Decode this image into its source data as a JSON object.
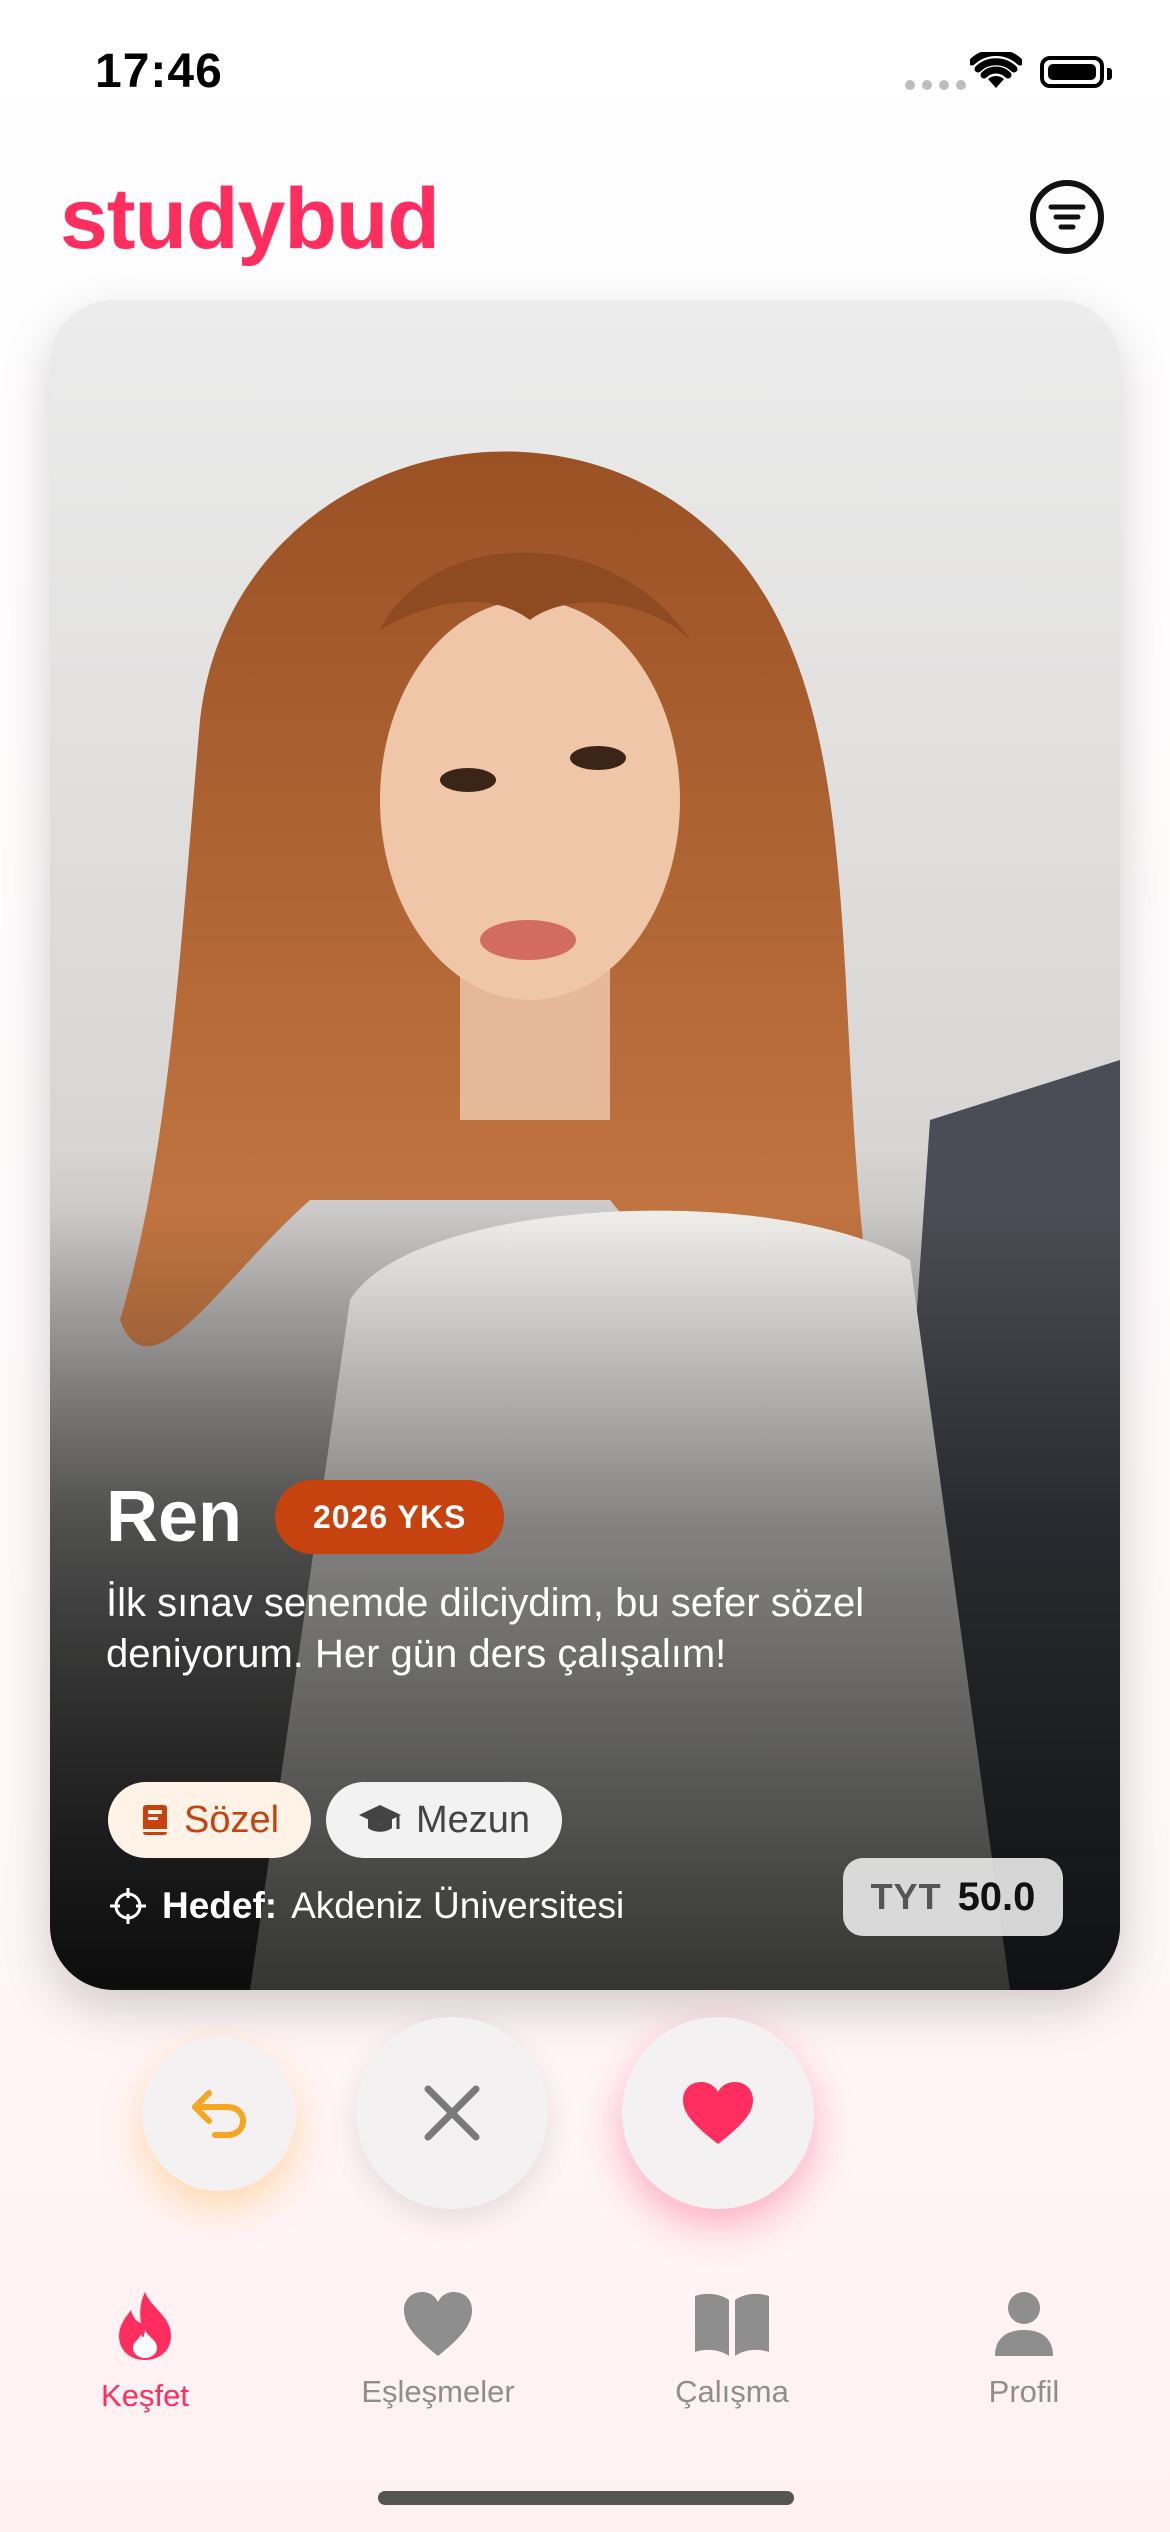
{
  "status_bar": {
    "time": "17:46"
  },
  "header": {
    "logo": "studybud",
    "filter_icon": "filter-icon"
  },
  "profile": {
    "name": "Ren",
    "exam_badge": "2026 YKS",
    "bio": "İlk sınav senemde dilciydim, bu sefer sözel deniyorum. Her gün ders çalışalım!",
    "tags": [
      {
        "label": "Sözel",
        "icon": "book-icon"
      },
      {
        "label": "Mezun",
        "icon": "graduation-cap-icon"
      }
    ],
    "goal_label": "Hedef:",
    "goal_value": "Akdeniz Üniversitesi",
    "score_label": "TYT",
    "score_value": "50.0"
  },
  "actions": {
    "undo": "undo-icon",
    "dislike": "close-icon",
    "like": "heart-icon"
  },
  "tabs": [
    {
      "label": "Keşfet",
      "icon": "flame-icon",
      "active": true
    },
    {
      "label": "Eşleşmeler",
      "icon": "heart-icon",
      "active": false
    },
    {
      "label": "Çalışma",
      "icon": "open-book-icon",
      "active": false
    },
    {
      "label": "Profil",
      "icon": "person-icon",
      "active": false
    }
  ],
  "colors": {
    "brand": "#ff2e5f",
    "badge": "#c6430f",
    "undo": "#f5a623"
  }
}
